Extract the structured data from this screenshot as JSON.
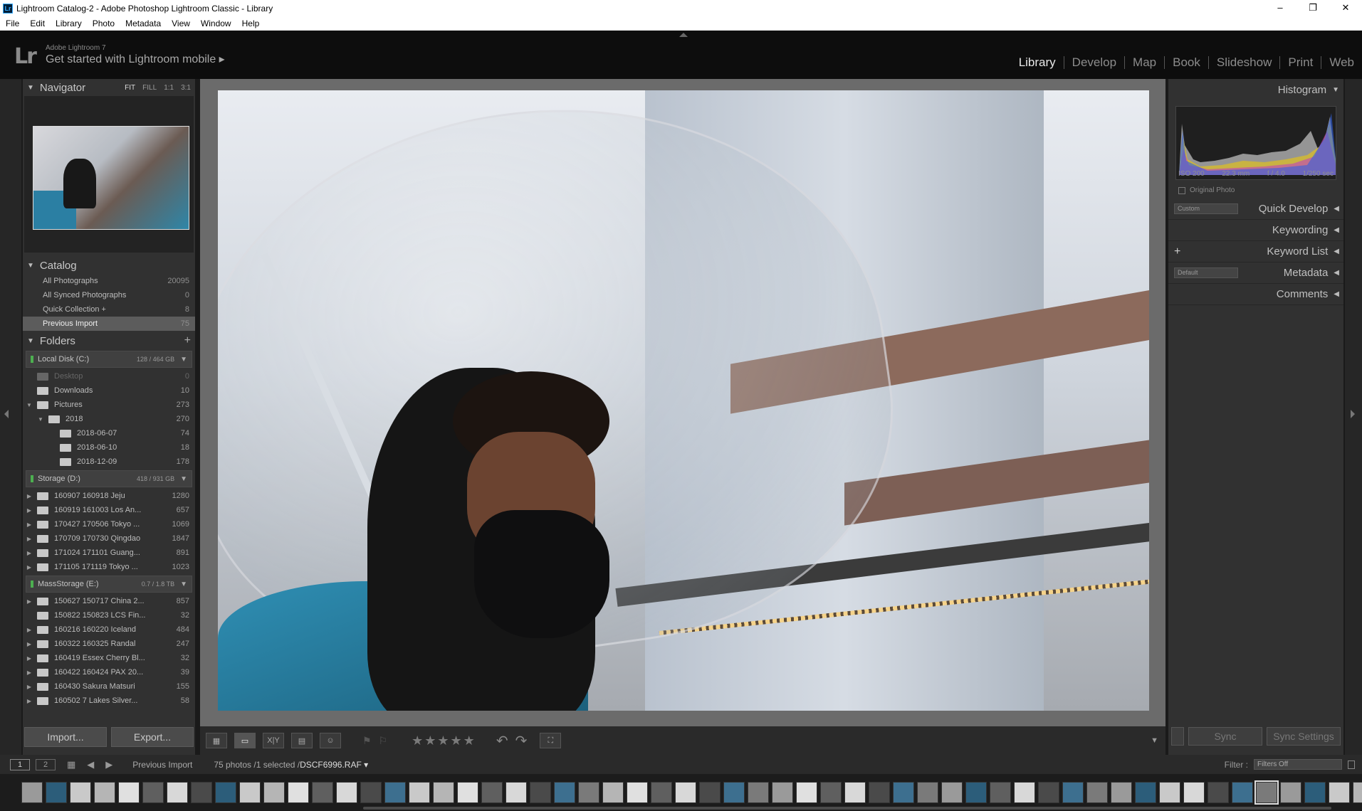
{
  "window": {
    "title": "Lightroom Catalog-2 - Adobe Photoshop Lightroom Classic - Library",
    "app_icon": "Lr",
    "minimize": "–",
    "restore": "❐",
    "close": "✕"
  },
  "menu": [
    "File",
    "Edit",
    "Library",
    "Photo",
    "Metadata",
    "View",
    "Window",
    "Help"
  ],
  "identity": {
    "logo": "Lr",
    "product": "Adobe Lightroom 7",
    "tagline": "Get started with Lightroom mobile ▸"
  },
  "modules": [
    "Library",
    "Develop",
    "Map",
    "Book",
    "Slideshow",
    "Print",
    "Web"
  ],
  "active_module": "Library",
  "navigator": {
    "title": "Navigator",
    "options": [
      "FIT",
      "FILL",
      "1:1",
      "3:1"
    ],
    "selected_option": "FIT"
  },
  "catalog": {
    "title": "Catalog",
    "items": [
      {
        "label": "All Photographs",
        "count": "20095"
      },
      {
        "label": "All Synced Photographs",
        "count": "0"
      },
      {
        "label": "Quick Collection +",
        "count": "8"
      },
      {
        "label": "Previous Import",
        "count": "75"
      }
    ],
    "selected": "Previous Import"
  },
  "folders": {
    "title": "Folders",
    "add": "+",
    "volumes": [
      {
        "name": "Local Disk (C:)",
        "capacity": "128 / 464 GB",
        "items": [
          {
            "label": "Desktop",
            "count": "0",
            "indent": 1,
            "arrow": "",
            "dim": true
          },
          {
            "label": "Downloads",
            "count": "10",
            "indent": 1,
            "arrow": ""
          },
          {
            "label": "Pictures",
            "count": "273",
            "indent": 1,
            "arrow": "▼"
          },
          {
            "label": "2018",
            "count": "270",
            "indent": 2,
            "arrow": "▼"
          },
          {
            "label": "2018-06-07",
            "count": "74",
            "indent": 3,
            "arrow": ""
          },
          {
            "label": "2018-06-10",
            "count": "18",
            "indent": 3,
            "arrow": ""
          },
          {
            "label": "2018-12-09",
            "count": "178",
            "indent": 3,
            "arrow": ""
          }
        ]
      },
      {
        "name": "Storage (D:)",
        "capacity": "418 / 931 GB",
        "items": [
          {
            "label": "160907 160918 Jeju",
            "count": "1280",
            "indent": 1,
            "arrow": "▶"
          },
          {
            "label": "160919 161003 Los An...",
            "count": "657",
            "indent": 1,
            "arrow": "▶"
          },
          {
            "label": "170427 170506 Tokyo ...",
            "count": "1069",
            "indent": 1,
            "arrow": "▶"
          },
          {
            "label": "170709 170730 Qingdao",
            "count": "1847",
            "indent": 1,
            "arrow": "▶"
          },
          {
            "label": "171024 171101 Guang...",
            "count": "891",
            "indent": 1,
            "arrow": "▶"
          },
          {
            "label": "171105 171119 Tokyo ...",
            "count": "1023",
            "indent": 1,
            "arrow": "▶"
          }
        ]
      },
      {
        "name": "MassStorage (E:)",
        "capacity": "0.7 / 1.8 TB",
        "items": [
          {
            "label": "150627 150717 China 2...",
            "count": "857",
            "indent": 1,
            "arrow": "▶"
          },
          {
            "label": "150822 150823 LCS Fin...",
            "count": "32",
            "indent": 1,
            "arrow": ""
          },
          {
            "label": "160216 160220 Iceland",
            "count": "484",
            "indent": 1,
            "arrow": "▶"
          },
          {
            "label": "160322 160325 Randal",
            "count": "247",
            "indent": 1,
            "arrow": "▶"
          },
          {
            "label": "160419 Essex Cherry Bl...",
            "count": "32",
            "indent": 1,
            "arrow": "▶"
          },
          {
            "label": "160422 160424 PAX 20...",
            "count": "39",
            "indent": 1,
            "arrow": "▶"
          },
          {
            "label": "160430 Sakura Matsuri",
            "count": "155",
            "indent": 1,
            "arrow": "▶"
          },
          {
            "label": "160502 7 Lakes Silver...",
            "count": "58",
            "indent": 1,
            "arrow": "▶"
          }
        ]
      }
    ]
  },
  "left_buttons": {
    "import": "Import...",
    "export": "Export..."
  },
  "toolbar": {
    "stars": "★★★★★",
    "menu_arrow": "▼"
  },
  "histogram": {
    "title": "Histogram",
    "iso": "ISO 200",
    "focal": "22.3 mm",
    "aperture": "f / 4.0",
    "shutter": "1/250 sec",
    "original_photo": "Original Photo"
  },
  "right_panels": {
    "quick_develop": {
      "title": "Quick Develop",
      "preset": "Custom"
    },
    "keywording": {
      "title": "Keywording"
    },
    "keyword_list": {
      "title": "Keyword List",
      "add": "+"
    },
    "metadata": {
      "title": "Metadata",
      "preset": "Default"
    },
    "comments": {
      "title": "Comments"
    }
  },
  "sync": {
    "sync": "Sync",
    "sync_settings": "Sync Settings"
  },
  "filmbar": {
    "monitor1": "1",
    "monitor2": "2",
    "source": "Previous Import",
    "count": "75 photos /1 selected /",
    "filename": "DSCF6996.RAF ▾",
    "filter_label": "Filter :",
    "filter_value": "Filters Off"
  },
  "colors": {
    "panel": "#313131",
    "background": "#1a1a1a",
    "active_text": "#e8e8e8"
  }
}
